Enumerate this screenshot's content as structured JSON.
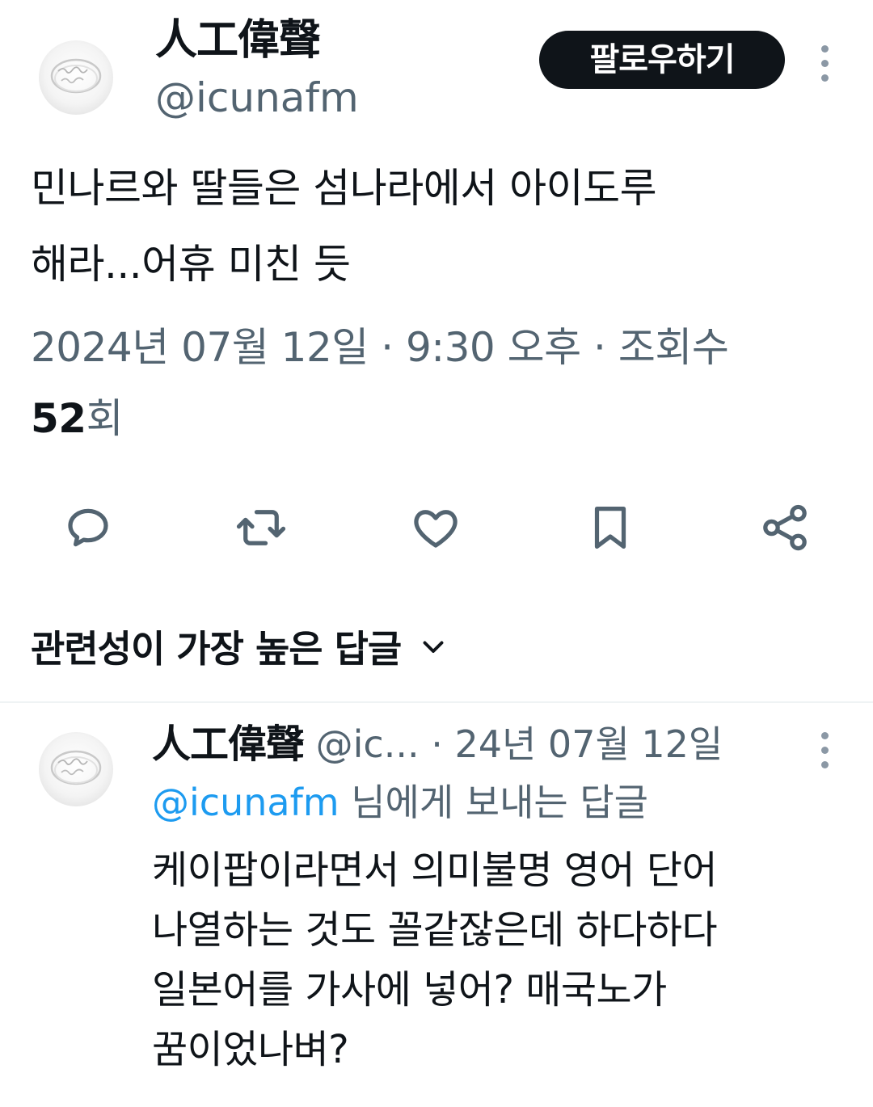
{
  "tweet": {
    "author": {
      "display_name": "人工偉聲",
      "handle": "@icunafm"
    },
    "follow_label": "팔로우하기",
    "text_line1": "민나르와 딸들은 섬나라에서 아이도루",
    "text_line2": "해라...어휴 미친 듯",
    "meta_line": "2024년 07월 12일 · 9:30 오후 · 조회수",
    "views_count": "52",
    "views_suffix": "회"
  },
  "actions": {
    "reply": "reply-icon",
    "retweet": "retweet-icon",
    "like": "heart-icon",
    "bookmark": "bookmark-icon",
    "share": "share-icon"
  },
  "sort": {
    "label": "관련성이 가장 높은 답글"
  },
  "reply": {
    "display_name": "人工偉聲",
    "handle_truncated": "@ic...",
    "date": "· 24년 07월 12일",
    "replying_mention": "@icunafm",
    "replying_suffix": " 님에게 보내는 답글",
    "text_lines": [
      "케이팝이라면서 의미불명 영어 단어",
      "나열하는 것도 꼴같잖은데 하다하다",
      "일본어를 가사에 넣어? 매국노가",
      "꿈이었나벼?"
    ]
  },
  "colors": {
    "text_primary": "#0f1419",
    "text_secondary": "#536471",
    "link_blue": "#1d9bf0",
    "follow_bg": "#0f1419",
    "divider": "#eff3f4"
  }
}
